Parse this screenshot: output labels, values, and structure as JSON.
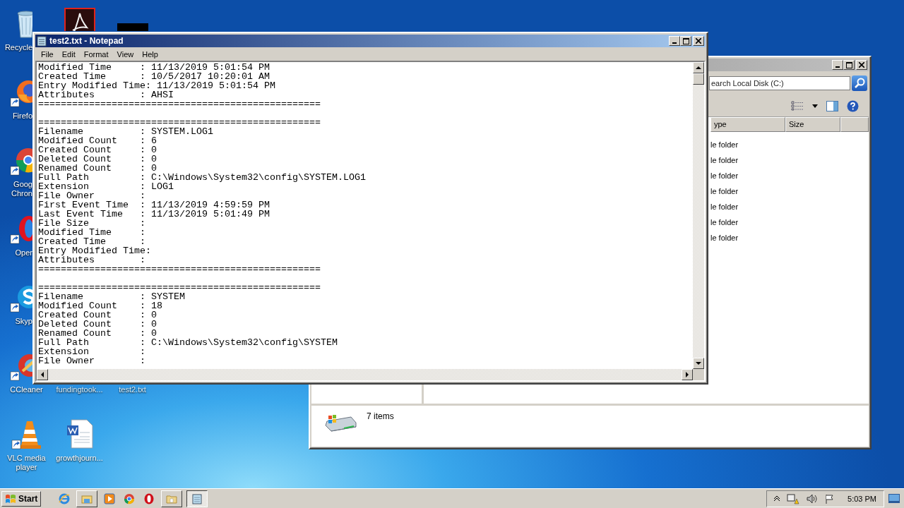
{
  "desktop_icons": [
    {
      "kind": "recycle",
      "label": "Recycle"
    },
    {
      "kind": "firefox",
      "label": "Firefo"
    },
    {
      "kind": "chrome",
      "label": "Goog Chron"
    },
    {
      "kind": "opera",
      "label": "Oper"
    },
    {
      "kind": "skype",
      "label": "Skyp"
    },
    {
      "kind": "ccleaner",
      "label": "CCleaner"
    },
    {
      "kind": "vlc",
      "label": "VLC media player"
    },
    {
      "kind": "acrobat"
    },
    {
      "kind": "file",
      "label": "fundingtook..."
    },
    {
      "kind": "word",
      "label": "growthjourn..."
    },
    {
      "kind": "black"
    },
    {
      "kind": "file",
      "label": "test2.txt"
    }
  ],
  "explorer": {
    "search": {
      "placeholder": "earch Local Disk (C:)"
    },
    "columns": [
      "ype",
      "Size"
    ],
    "rows": [
      {
        "type": "le folder"
      },
      {
        "type": "le folder"
      },
      {
        "type": "le folder"
      },
      {
        "type": "le folder"
      },
      {
        "type": "le folder"
      },
      {
        "type": "le folder"
      },
      {
        "type": "le folder"
      }
    ],
    "status": "7 items"
  },
  "notepad": {
    "title": "test2.txt - Notepad",
    "menu": [
      "File",
      "Edit",
      "Format",
      "View",
      "Help"
    ],
    "sections": [
      [
        "Modified Time     : 11/13/2019 5:01:54 PM",
        "Created Time      : 10/5/2017 10:20:01 AM",
        "Entry Modified Time: 11/13/2019 5:01:54 PM",
        "Attributes        : AHSI",
        "=================================================="
      ],
      [
        "==================================================",
        "Filename          : SYSTEM.LOG1",
        "Modified Count    : 6",
        "Created Count     : 0",
        "Deleted Count     : 0",
        "Renamed Count     : 0",
        "Full Path         : C:\\Windows\\System32\\config\\SYSTEM.LOG1",
        "Extension         : LOG1",
        "File Owner        :",
        "First Event Time  : 11/13/2019 4:59:59 PM",
        "Last Event Time   : 11/13/2019 5:01:49 PM",
        "File Size         :",
        "Modified Time     :",
        "Created Time      :",
        "Entry Modified Time:",
        "Attributes        :",
        "=================================================="
      ],
      [
        "==================================================",
        "Filename          : SYSTEM",
        "Modified Count    : 18",
        "Created Count     : 0",
        "Deleted Count     : 0",
        "Renamed Count     : 0",
        "Full Path         : C:\\Windows\\System32\\config\\SYSTEM",
        "Extension         :",
        "File Owner        :"
      ]
    ]
  },
  "taskbar": {
    "start": "Start",
    "items": [
      {
        "kind": "ie",
        "running": false,
        "selected": false
      },
      {
        "kind": "explorer",
        "running": true,
        "selected": false
      },
      {
        "kind": "media",
        "running": false,
        "selected": false
      },
      {
        "kind": "chrome",
        "running": false,
        "selected": false
      },
      {
        "kind": "opera",
        "running": false,
        "selected": false
      },
      {
        "kind": "folder",
        "running": true,
        "selected": false
      },
      {
        "kind": "notepad",
        "running": true,
        "selected": true
      }
    ],
    "time": "5:03 PM"
  }
}
